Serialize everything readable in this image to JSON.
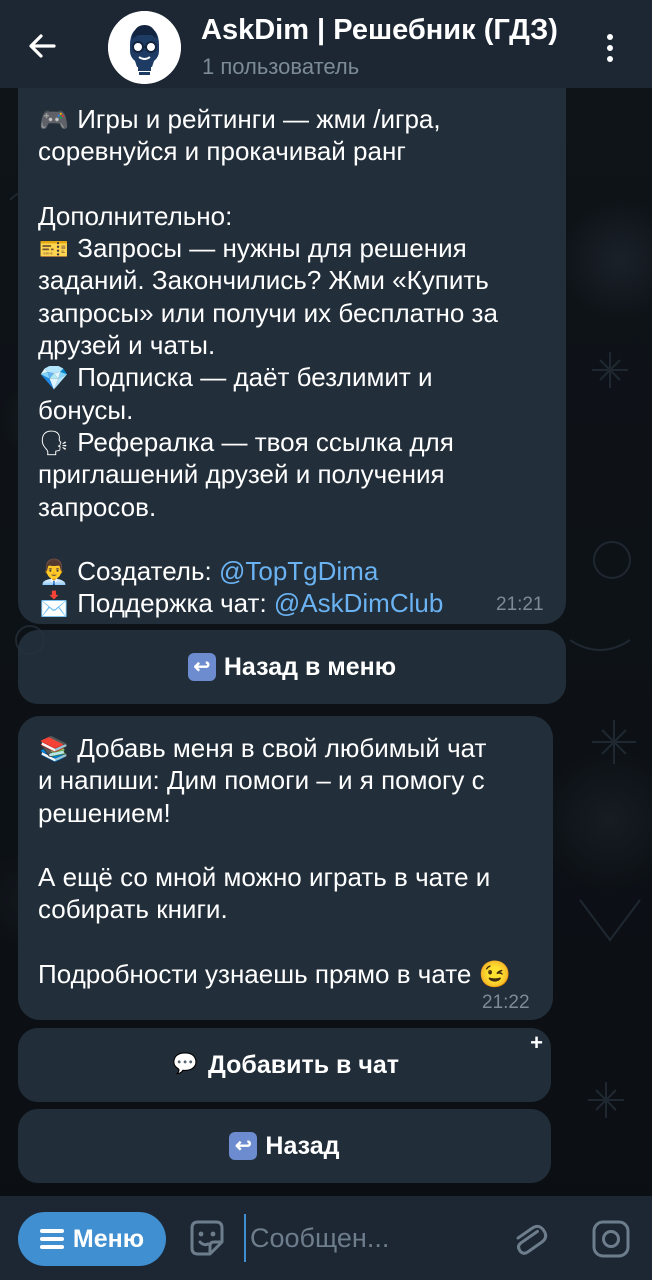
{
  "header": {
    "title": "AskDim | Решебник (ГДЗ)",
    "subtitle": "1 пользователь"
  },
  "messages": [
    {
      "lines": [
        {
          "emoji": "🎮",
          "text": "Игры и рейтинги — жми /игра,"
        },
        {
          "emoji": "",
          "text": "соревнуйся и прокачивай ранг"
        },
        {
          "emoji": "",
          "text": ""
        },
        {
          "emoji": "",
          "text": "Дополнительно:"
        },
        {
          "emoji": "🎫",
          "text": "Запросы — нужны для решения"
        },
        {
          "emoji": "",
          "text": "заданий. Закончились? Жми «Купить"
        },
        {
          "emoji": "",
          "text": "запросы» или получи их бесплатно за"
        },
        {
          "emoji": "",
          "text": "друзей и чаты."
        },
        {
          "emoji": "💎",
          "text": "Подписка — даёт безлимит и"
        },
        {
          "emoji": "",
          "text": "бонусы."
        },
        {
          "emoji": "🗣",
          "text": "Рефералка — твоя ссылка для"
        },
        {
          "emoji": "",
          "text": "приглашений друзей и получения"
        },
        {
          "emoji": "",
          "text": "запросов."
        },
        {
          "emoji": "",
          "text": ""
        }
      ],
      "creator_label": "Создатель: ",
      "creator_link": "@TopTgDima",
      "support_label": "Поддержка чат: ",
      "support_link": "@AskDimClub",
      "creator_emoji": "👨‍💼",
      "support_emoji": "📩",
      "time": "21:21",
      "buttons": [
        {
          "icon": "↩",
          "label": "Назад в меню"
        }
      ]
    },
    {
      "lines": [
        {
          "emoji": "📚",
          "text": "Добавь меня в свой любимый чат"
        },
        {
          "emoji": "",
          "text": "и напиши: Дим помоги – и я помогу с"
        },
        {
          "emoji": "",
          "text": "решением!"
        },
        {
          "emoji": "",
          "text": ""
        },
        {
          "emoji": "",
          "text": "А ещё со мной можно играть в чате и"
        },
        {
          "emoji": "",
          "text": "собирать книги."
        },
        {
          "emoji": "",
          "text": ""
        },
        {
          "emoji": "",
          "text": "Подробности узнаешь прямо в чате 😉"
        }
      ],
      "time": "21:22",
      "buttons": [
        {
          "icon": "💬",
          "label": "Добавить в чат",
          "corner": "+"
        },
        {
          "icon": "↩",
          "label": "Назад"
        }
      ]
    }
  ],
  "input_bar": {
    "menu_label": "Меню",
    "placeholder": "Сообщен..."
  },
  "icons": {
    "back": "arrow-left-icon",
    "more": "more-vertical-icon",
    "sticker": "sticker-icon",
    "attach": "paperclip-icon",
    "camera": "camera-icon"
  },
  "colors": {
    "header_bg": "#1c2733",
    "bubble_bg": "#222e39",
    "link": "#6ab2f2",
    "accent": "#3f8fd1",
    "meta_text": "#7d8b99"
  }
}
